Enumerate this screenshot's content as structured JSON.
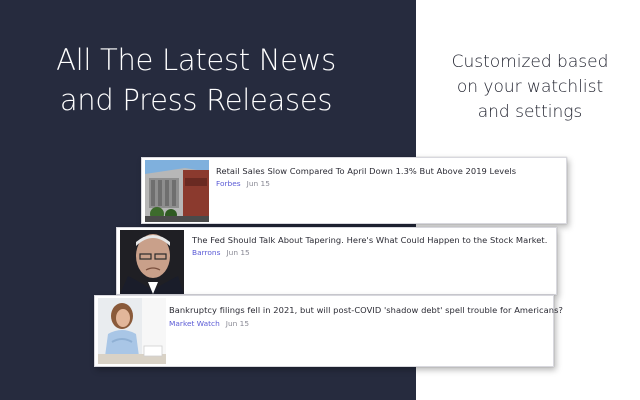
{
  "hero": {
    "title_line1": "All The Latest News",
    "title_line2": "and Press Releases"
  },
  "side": {
    "line1": "Customized based",
    "line2": "on your watchlist",
    "line3": "and settings"
  },
  "news": [
    {
      "headline": "Retail Sales Slow Compared To April Down 1.3% But Above 2019 Levels",
      "source": "Forbes",
      "date": "Jun 15",
      "image_icon": "store-building-photo"
    },
    {
      "headline": "The Fed Should Talk About Tapering. Here's What Could Happen to the Stock Market.",
      "source": "Barrons",
      "date": "Jun 15",
      "image_icon": "man-portrait-photo"
    },
    {
      "headline": "Bankruptcy filings fell in 2021, but will post-COVID 'shadow debt' spell trouble for Americans?",
      "source": "Market Watch",
      "date": "Jun 15",
      "image_icon": "woman-at-desk-photo"
    }
  ],
  "colors": {
    "panel_bg": "#262b3e",
    "source_link": "#5b5bd6",
    "date_text": "#8a8a95"
  }
}
